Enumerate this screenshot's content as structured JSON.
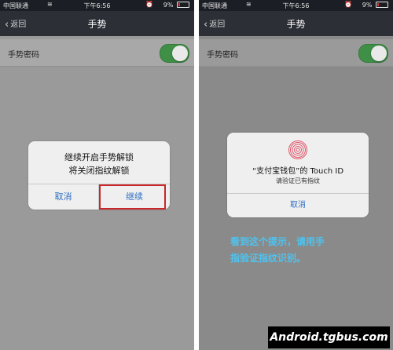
{
  "status_left": {
    "carrier": "中国联通",
    "time": "下午6:56",
    "battery": "9%"
  },
  "status_right": {
    "carrier": "中国联通",
    "time": "下午6:56",
    "battery": "9%"
  },
  "left": {
    "nav": {
      "back": "返回",
      "title": "手势"
    },
    "setting": {
      "label": "手势密码",
      "toggle_on": true
    },
    "dialog": {
      "line1": "继续开启手势解锁",
      "line2": "将关闭指纹解锁",
      "cancel": "取消",
      "continue": "继续"
    }
  },
  "right": {
    "nav": {
      "back": "返回",
      "title": "手势"
    },
    "setting": {
      "label": "手势密码",
      "toggle_on": true
    },
    "dialog": {
      "title": "“支付宝钱包”的 Touch ID",
      "message": "请验证已有指纹",
      "cancel": "取消"
    },
    "hint_line1": "看到这个提示，请用手",
    "hint_line2": "指验证指纹识别。"
  },
  "watermark": "Android.tgbus.com",
  "colors": {
    "accent": "#2f6fc5",
    "toggle": "#3f8f46",
    "highlight": "#c8262a",
    "hint": "#4ec3f0"
  }
}
